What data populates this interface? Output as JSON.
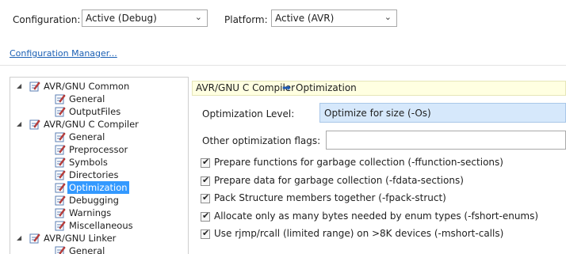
{
  "config": {
    "configuration_label": "Configuration:",
    "configuration_value": "Active (Debug)",
    "platform_label": "Platform:",
    "platform_value": "Active (AVR)",
    "manager_link": "Configuration Manager..."
  },
  "tree": [
    {
      "label": "AVR/GNU Common",
      "level": 0,
      "expanded": true
    },
    {
      "label": "General",
      "level": 1
    },
    {
      "label": "OutputFiles",
      "level": 1
    },
    {
      "label": "AVR/GNU C Compiler",
      "level": 0,
      "expanded": true
    },
    {
      "label": "General",
      "level": 1
    },
    {
      "label": "Preprocessor",
      "level": 1
    },
    {
      "label": "Symbols",
      "level": 1
    },
    {
      "label": "Directories",
      "level": 1
    },
    {
      "label": "Optimization",
      "level": 1,
      "selected": true
    },
    {
      "label": "Debugging",
      "level": 1
    },
    {
      "label": "Warnings",
      "level": 1
    },
    {
      "label": "Miscellaneous",
      "level": 1
    },
    {
      "label": "AVR/GNU Linker",
      "level": 0,
      "expanded": true
    },
    {
      "label": "General",
      "level": 1
    }
  ],
  "panel": {
    "breadcrumb_parent": "AVR/GNU C Compiler",
    "breadcrumb_child": "Optimization",
    "optimization_level_label": "Optimization Level:",
    "optimization_level_value": "Optimize for size (-Os)",
    "other_flags_label": "Other optimization flags:",
    "other_flags_value": "",
    "options": [
      {
        "label": "Prepare functions for garbage collection (-ffunction-sections)",
        "checked": true
      },
      {
        "label": "Prepare data for garbage collection (-fdata-sections)",
        "checked": true
      },
      {
        "label": "Pack Structure members together (-fpack-struct)",
        "checked": true
      },
      {
        "label": "Allocate only as many bytes needed by enum types (-fshort-enums)",
        "checked": true
      },
      {
        "label": "Use rjmp/rcall (limited range) on >8K devices (-mshort-calls)",
        "checked": true
      }
    ]
  },
  "colors": {
    "selection": "#3399ff",
    "header_bg": "#ffffe1",
    "field_highlight": "#d6e8fb",
    "link": "#1a5fb4"
  }
}
